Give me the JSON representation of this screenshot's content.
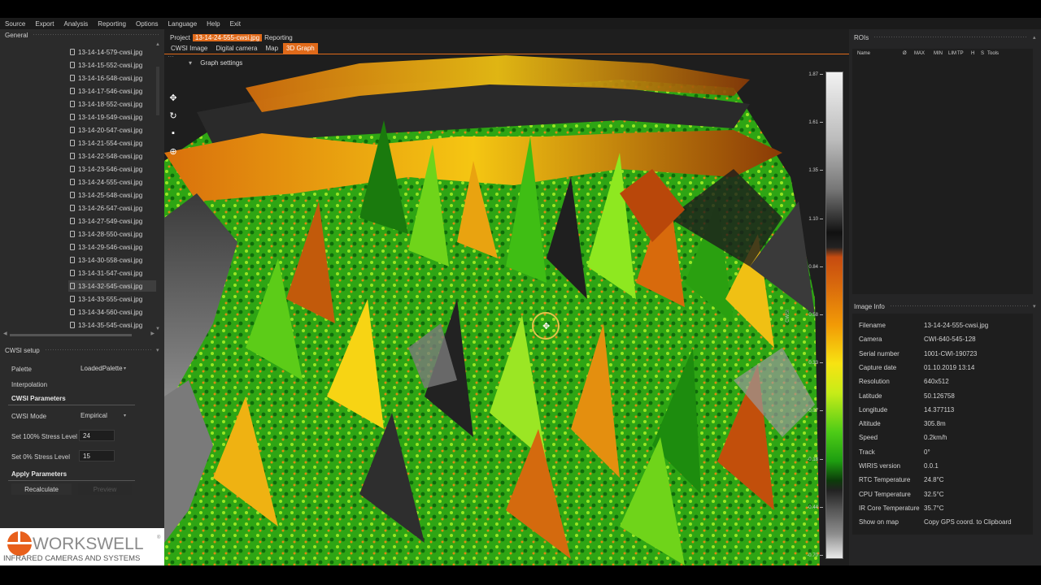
{
  "menu": [
    "Source",
    "Export",
    "Analysis",
    "Reporting",
    "Options",
    "Language",
    "Help",
    "Exit"
  ],
  "left_panel": {
    "title": "General",
    "files": [
      "13-14-14-579-cwsi.jpg",
      "13-14-15-552-cwsi.jpg",
      "13-14-16-548-cwsi.jpg",
      "13-14-17-546-cwsi.jpg",
      "13-14-18-552-cwsi.jpg",
      "13-14-19-549-cwsi.jpg",
      "13-14-20-547-cwsi.jpg",
      "13-14-21-554-cwsi.jpg",
      "13-14-22-548-cwsi.jpg",
      "13-14-23-546-cwsi.jpg",
      "13-14-24-555-cwsi.jpg",
      "13-14-25-548-cwsi.jpg",
      "13-14-26-547-cwsi.jpg",
      "13-14-27-549-cwsi.jpg",
      "13-14-28-550-cwsi.jpg",
      "13-14-29-546-cwsi.jpg",
      "13-14-30-558-cwsi.jpg",
      "13-14-31-547-cwsi.jpg",
      "13-14-32-545-cwsi.jpg",
      "13-14-33-555-cwsi.jpg",
      "13-14-34-560-cwsi.jpg",
      "13-14-35-545-cwsi.jpg"
    ],
    "selected_file": "13-14-32-545-cwsi.jpg"
  },
  "cwsi_setup": {
    "title": "CWSI setup",
    "palette_label": "Palette",
    "palette_value": "LoadedPalette",
    "interpolation_label": "Interpolation",
    "params_title": "CWSI Parameters",
    "mode_label": "CWSI Mode",
    "mode_value": "Empirical",
    "stress100_label": "Set 100% Stress Level",
    "stress100_value": "24",
    "stress0_label": "Set 0% Stress Level",
    "stress0_value": "15",
    "apply_title": "Apply Parameters",
    "recalculate": "Recalculate",
    "preview": "Preview"
  },
  "logo": {
    "brand": "WORKSWELL",
    "tagline": "INFRARED CAMERAS AND SYSTEMS",
    "mark": "®"
  },
  "center": {
    "breadcrumb": [
      "Project",
      "13-14-24-555-cwsi.jpg",
      "Reporting"
    ],
    "tabs": [
      "CWSI Image",
      "Digital camera",
      "Map",
      "3D Graph"
    ],
    "active_tab": "3D Graph",
    "graph_settings": "Graph settings",
    "colorbar_label": "CWSI",
    "colorbar_ticks": [
      "1.87",
      "1.61",
      "1.35",
      "1.10",
      "0.84",
      "0.58",
      "0.33",
      "0.07",
      "-0.18",
      "-0.44",
      "-0.70"
    ]
  },
  "rois": {
    "title": "ROIs",
    "columns": [
      "Name",
      "Ø",
      "MAX",
      "MIN",
      "LIM",
      "TP",
      "H",
      "S",
      "Tools"
    ]
  },
  "image_info": {
    "title": "Image Info",
    "rows": [
      {
        "k": "Filename",
        "v": "13-14-24-555-cwsi.jpg"
      },
      {
        "k": "Camera",
        "v": "CWI-640-545-128"
      },
      {
        "k": "Serial number",
        "v": "1001-CWI-190723"
      },
      {
        "k": "Capture date",
        "v": "01.10.2019 13:14"
      },
      {
        "k": "Resolution",
        "v": "640x512"
      },
      {
        "k": "Latitude",
        "v": "50.126758"
      },
      {
        "k": "Longitude",
        "v": "14.377113"
      },
      {
        "k": "Altitude",
        "v": "305.8m"
      },
      {
        "k": "Speed",
        "v": "0.2km/h"
      },
      {
        "k": "Track",
        "v": "0°"
      },
      {
        "k": "WIRIS version",
        "v": "0.0.1"
      },
      {
        "k": "RTC Temperature",
        "v": "24.8°C"
      },
      {
        "k": "CPU Temperature",
        "v": "32.5°C"
      },
      {
        "k": "IR Core Temperature",
        "v": "35.7°C"
      },
      {
        "k": "Show on map",
        "v": "Copy GPS coord. to Clipboard"
      }
    ]
  },
  "colors": {
    "accent": "#e06a1a",
    "panel_bg": "#2b2b2b"
  }
}
